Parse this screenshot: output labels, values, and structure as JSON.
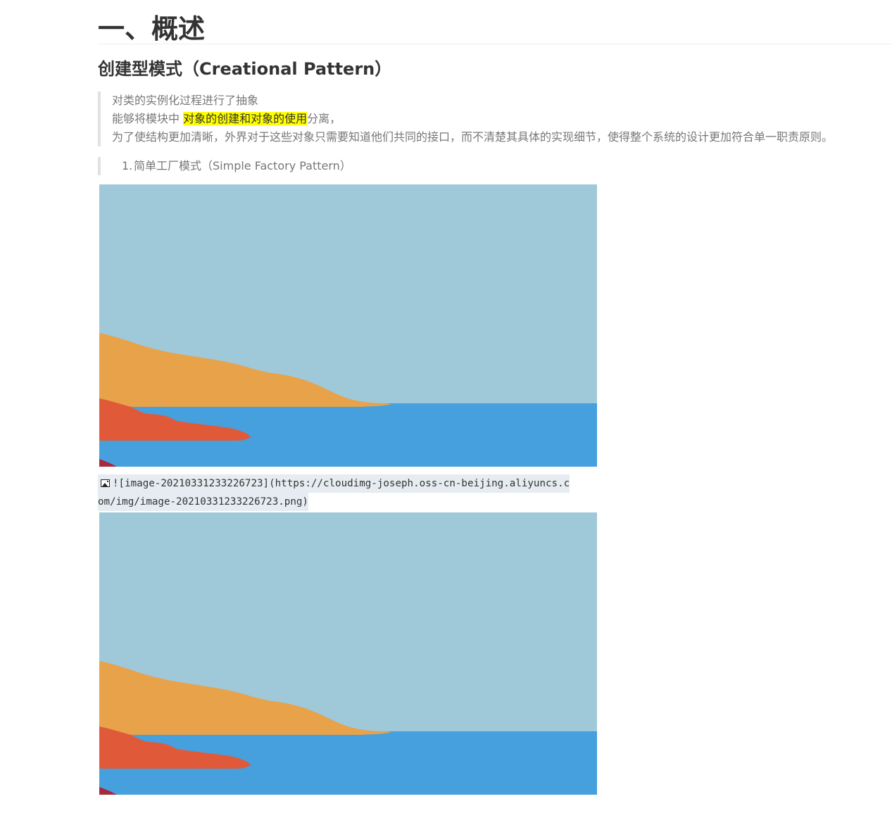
{
  "heading1": "一、概述",
  "heading2": "创建型模式（Creational Pattern）",
  "blockquote": {
    "line1": "对类的实例化过程进行了抽象",
    "line2_prefix": "能够将模块中 ",
    "line2_highlight": "对象的创建和对象的使用",
    "line2_suffix": "分离，",
    "line3": "为了使结构更加清晰，外界对于这些对象只需要知道他们共同的接口，而不清楚其具体的实现细节，使得整个系统的设计更加符合单一职责原则。"
  },
  "list_item": {
    "number": "1.",
    "text": "简单工厂模式（Simple Factory Pattern）"
  },
  "image_source": {
    "icon": "image-icon",
    "line1": "![image-20210331233226723](https://cloudimg-joseph.oss-cn-beijing.aliyuncs.c",
    "line2": "om/img/image-20210331233226723.png)"
  },
  "illustration_colors": {
    "sky": "#9fc8d9",
    "sea": "#45a0dd",
    "orange_land": "#e8a249",
    "red_land": "#e05a3a",
    "dark_red": "#a8283e"
  },
  "highlight_color": "#ffff00"
}
